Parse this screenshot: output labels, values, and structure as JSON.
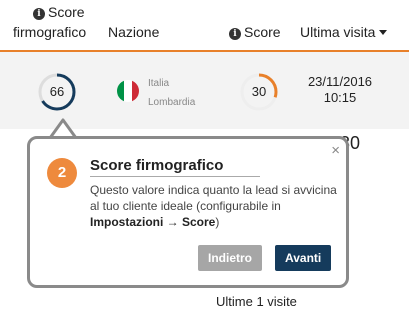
{
  "table": {
    "headers": {
      "score_firmo_line1": "Score",
      "score_firmo_line2": "firmografico",
      "nazione": "Nazione",
      "score": "Score",
      "ultima_visita": "Ultima visita"
    },
    "row": {
      "firmo_score": 66,
      "firmo_score_label": "66",
      "country": "Italia",
      "region": "Lombardia",
      "score": 30,
      "score_label": "30",
      "visit_date": "23/11/2016",
      "visit_time": "10:15"
    },
    "partially_hidden_number": "30",
    "visits_summary": "Ultime 1 visite"
  },
  "tooltip": {
    "step": "2",
    "title": "Score firmografico",
    "body_text": "Questo valore indica quanto la lead si avvicina al tuo cliente ideale (configurabile in ",
    "body_settings": "Impostazioni → Score",
    "body_end": ")",
    "close_label": "×",
    "back_label": "Indietro",
    "next_label": "Avanti"
  },
  "icons": {
    "info": "info-icon",
    "sort": "caret-down-icon",
    "close": "close-icon"
  },
  "colors": {
    "accent_orange": "#e8802a",
    "gauge_blue": "#153b5c",
    "button_dark": "#153b5c",
    "button_grey": "#a6a6a6",
    "flag_green": "#009246",
    "flag_white": "#ffffff",
    "flag_red": "#ce2b37"
  }
}
